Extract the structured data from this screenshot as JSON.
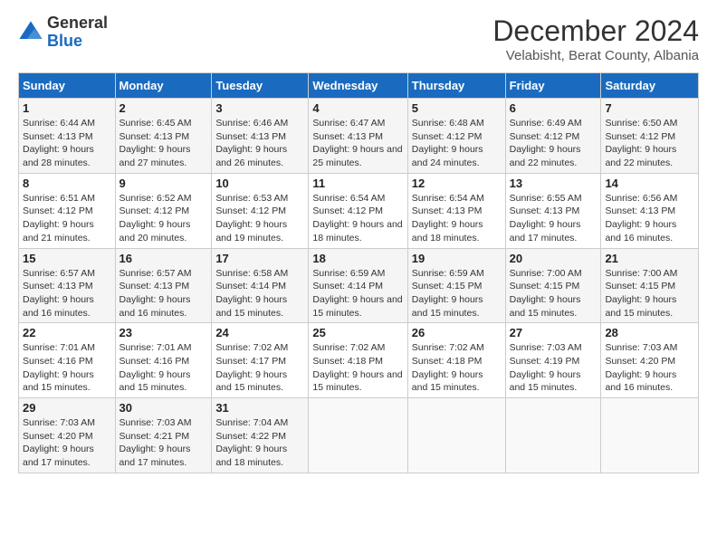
{
  "logo": {
    "general": "General",
    "blue": "Blue"
  },
  "title": "December 2024",
  "subtitle": "Velabisht, Berat County, Albania",
  "days_of_week": [
    "Sunday",
    "Monday",
    "Tuesday",
    "Wednesday",
    "Thursday",
    "Friday",
    "Saturday"
  ],
  "weeks": [
    [
      {
        "day": "1",
        "sunrise": "6:44 AM",
        "sunset": "4:13 PM",
        "daylight": "9 hours and 28 minutes."
      },
      {
        "day": "2",
        "sunrise": "6:45 AM",
        "sunset": "4:13 PM",
        "daylight": "9 hours and 27 minutes."
      },
      {
        "day": "3",
        "sunrise": "6:46 AM",
        "sunset": "4:13 PM",
        "daylight": "9 hours and 26 minutes."
      },
      {
        "day": "4",
        "sunrise": "6:47 AM",
        "sunset": "4:13 PM",
        "daylight": "9 hours and 25 minutes."
      },
      {
        "day": "5",
        "sunrise": "6:48 AM",
        "sunset": "4:12 PM",
        "daylight": "9 hours and 24 minutes."
      },
      {
        "day": "6",
        "sunrise": "6:49 AM",
        "sunset": "4:12 PM",
        "daylight": "9 hours and 22 minutes."
      },
      {
        "day": "7",
        "sunrise": "6:50 AM",
        "sunset": "4:12 PM",
        "daylight": "9 hours and 22 minutes."
      }
    ],
    [
      {
        "day": "8",
        "sunrise": "6:51 AM",
        "sunset": "4:12 PM",
        "daylight": "9 hours and 21 minutes."
      },
      {
        "day": "9",
        "sunrise": "6:52 AM",
        "sunset": "4:12 PM",
        "daylight": "9 hours and 20 minutes."
      },
      {
        "day": "10",
        "sunrise": "6:53 AM",
        "sunset": "4:12 PM",
        "daylight": "9 hours and 19 minutes."
      },
      {
        "day": "11",
        "sunrise": "6:54 AM",
        "sunset": "4:12 PM",
        "daylight": "9 hours and 18 minutes."
      },
      {
        "day": "12",
        "sunrise": "6:54 AM",
        "sunset": "4:13 PM",
        "daylight": "9 hours and 18 minutes."
      },
      {
        "day": "13",
        "sunrise": "6:55 AM",
        "sunset": "4:13 PM",
        "daylight": "9 hours and 17 minutes."
      },
      {
        "day": "14",
        "sunrise": "6:56 AM",
        "sunset": "4:13 PM",
        "daylight": "9 hours and 16 minutes."
      }
    ],
    [
      {
        "day": "15",
        "sunrise": "6:57 AM",
        "sunset": "4:13 PM",
        "daylight": "9 hours and 16 minutes."
      },
      {
        "day": "16",
        "sunrise": "6:57 AM",
        "sunset": "4:13 PM",
        "daylight": "9 hours and 16 minutes."
      },
      {
        "day": "17",
        "sunrise": "6:58 AM",
        "sunset": "4:14 PM",
        "daylight": "9 hours and 15 minutes."
      },
      {
        "day": "18",
        "sunrise": "6:59 AM",
        "sunset": "4:14 PM",
        "daylight": "9 hours and 15 minutes."
      },
      {
        "day": "19",
        "sunrise": "6:59 AM",
        "sunset": "4:15 PM",
        "daylight": "9 hours and 15 minutes."
      },
      {
        "day": "20",
        "sunrise": "7:00 AM",
        "sunset": "4:15 PM",
        "daylight": "9 hours and 15 minutes."
      },
      {
        "day": "21",
        "sunrise": "7:00 AM",
        "sunset": "4:15 PM",
        "daylight": "9 hours and 15 minutes."
      }
    ],
    [
      {
        "day": "22",
        "sunrise": "7:01 AM",
        "sunset": "4:16 PM",
        "daylight": "9 hours and 15 minutes."
      },
      {
        "day": "23",
        "sunrise": "7:01 AM",
        "sunset": "4:16 PM",
        "daylight": "9 hours and 15 minutes."
      },
      {
        "day": "24",
        "sunrise": "7:02 AM",
        "sunset": "4:17 PM",
        "daylight": "9 hours and 15 minutes."
      },
      {
        "day": "25",
        "sunrise": "7:02 AM",
        "sunset": "4:18 PM",
        "daylight": "9 hours and 15 minutes."
      },
      {
        "day": "26",
        "sunrise": "7:02 AM",
        "sunset": "4:18 PM",
        "daylight": "9 hours and 15 minutes."
      },
      {
        "day": "27",
        "sunrise": "7:03 AM",
        "sunset": "4:19 PM",
        "daylight": "9 hours and 15 minutes."
      },
      {
        "day": "28",
        "sunrise": "7:03 AM",
        "sunset": "4:20 PM",
        "daylight": "9 hours and 16 minutes."
      }
    ],
    [
      {
        "day": "29",
        "sunrise": "7:03 AM",
        "sunset": "4:20 PM",
        "daylight": "9 hours and 17 minutes."
      },
      {
        "day": "30",
        "sunrise": "7:03 AM",
        "sunset": "4:21 PM",
        "daylight": "9 hours and 17 minutes."
      },
      {
        "day": "31",
        "sunrise": "7:04 AM",
        "sunset": "4:22 PM",
        "daylight": "9 hours and 18 minutes."
      },
      null,
      null,
      null,
      null
    ]
  ]
}
